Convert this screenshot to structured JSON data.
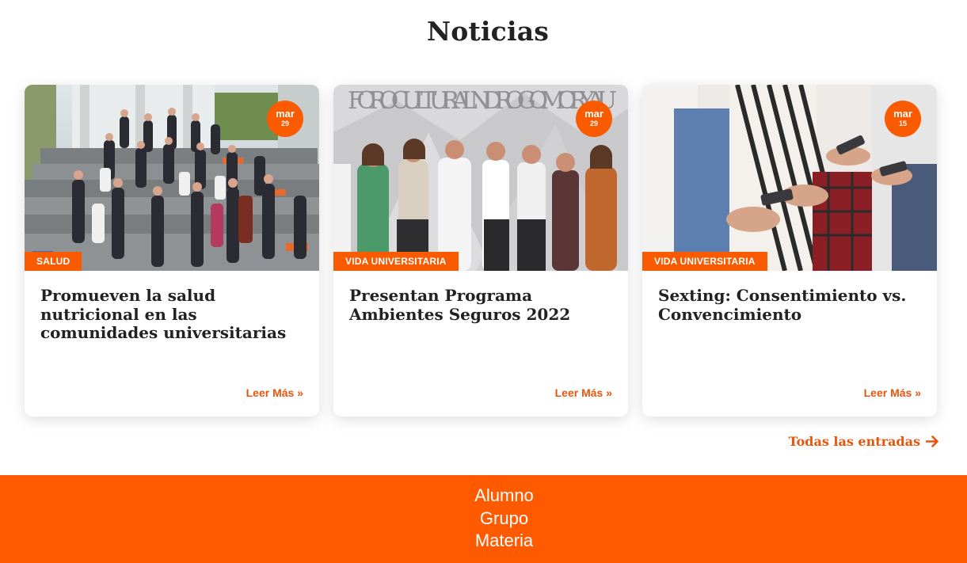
{
  "section": {
    "title": "Noticias"
  },
  "colors": {
    "accent": "#fa5a00",
    "footer_bg": "#ff5a00",
    "text": "#222222"
  },
  "cards": [
    {
      "date_month": "mar",
      "date_day": "29",
      "category": "SALUD",
      "title": "Promueven la salud nutricional en las comunidades universitarias",
      "read_more": "Leer Más »"
    },
    {
      "date_month": "mar",
      "date_day": "29",
      "category": "VIDA UNIVERSITARIA",
      "title": "Presentan Programa Ambientes Seguros 2022",
      "read_more": "Leer Más »",
      "image_text": "FORO CULTURAL NDRO GOMORY AU"
    },
    {
      "date_month": "mar",
      "date_day": "15",
      "category": "VIDA UNIVERSITARIA",
      "title": "Sexting: Consentimiento vs. Convencimiento",
      "read_more": "Leer Más »"
    }
  ],
  "all_entries": {
    "label": "Todas las entradas",
    "icon": "arrow-right-icon"
  },
  "footer": {
    "lines": [
      "Alumno",
      "Grupo",
      "Materia"
    ]
  }
}
